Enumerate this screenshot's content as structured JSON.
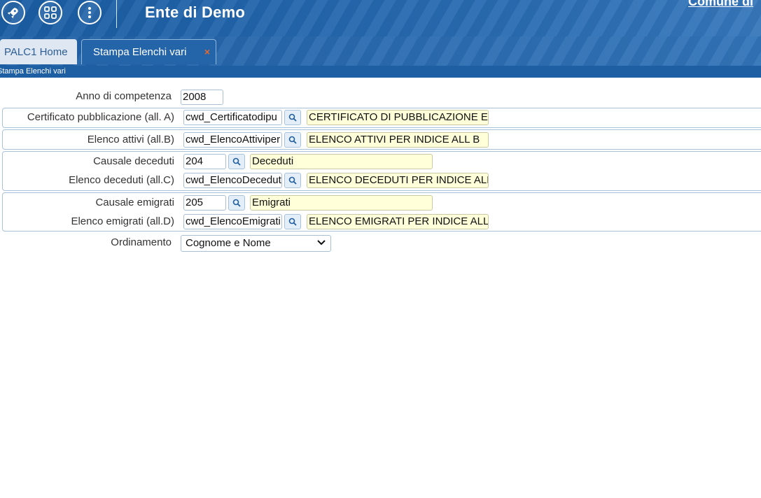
{
  "header": {
    "title": "Ente di Demo",
    "comune": "Comune di",
    "icons": [
      "rocket-icon",
      "grid-apps-icon",
      "more-vertical-icon"
    ]
  },
  "tabs": {
    "home_label": "PALC1 Home",
    "active_label": "Stampa Elenchi vari",
    "close_glyph": "×"
  },
  "breadcrumb": "Stampa Elenchi vari",
  "form": {
    "anno": {
      "label": "Anno di competenza",
      "value": "2008"
    },
    "certificato": {
      "label": "Certificato pubblicazione (all. A)",
      "code": "cwd_Certificatodipu",
      "description": "CERTIFICATO DI PUBBLICAZIONE ELE"
    },
    "attivi": {
      "label": "Elenco attivi (all.B)",
      "code": "cwd_ElencoAttiviper",
      "description": "ELENCO ATTIVI PER INDICE ALL B"
    },
    "causale_deceduti": {
      "label": "Causale deceduti",
      "code": "204",
      "description": "Deceduti"
    },
    "deceduti": {
      "label": "Elenco deceduti (all.C)",
      "code": "cwd_ElencoDecedut",
      "description": "ELENCO DECEDUTI PER INDICE ALL C"
    },
    "causale_emigrati": {
      "label": "Causale emigrati",
      "code": "205",
      "description": "Emigrati"
    },
    "emigrati": {
      "label": "Elenco emigrati (all.D)",
      "code": "cwd_ElencoEmigrati",
      "description": "ELENCO EMIGRATI PER INDICE ALL D"
    },
    "ordinamento": {
      "label": "Ordinamento",
      "selected": "Cognome e Nome"
    }
  },
  "colors": {
    "header_blue": "#1a5da3",
    "tab_close": "#e8692c",
    "description_bg": "#ffffd9"
  }
}
